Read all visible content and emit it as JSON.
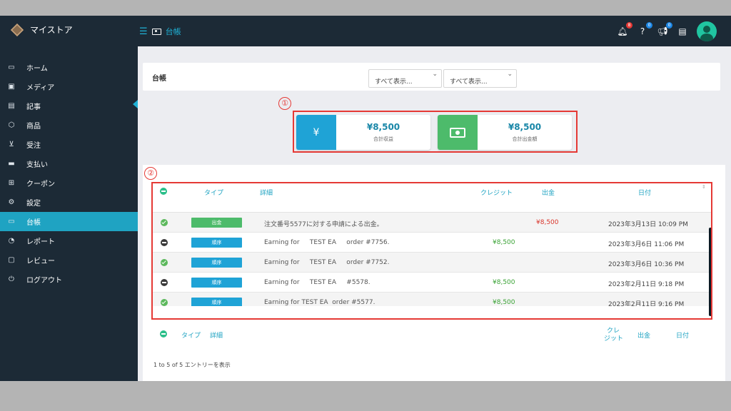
{
  "app": {
    "name": "マイストア"
  },
  "topbar": {
    "breadcrumb": "台帳",
    "notifications_count": "8",
    "help_count": "0",
    "announcements_count": "0",
    "colors": {
      "notif": "#e53935",
      "help": "#1e88e5",
      "announce": "#1e88e5"
    }
  },
  "sidebar": {
    "items": [
      {
        "label": "ホーム",
        "icon": "monitor-icon"
      },
      {
        "label": "メディア",
        "icon": "image-icon"
      },
      {
        "label": "記事",
        "icon": "document-icon"
      },
      {
        "label": "商品",
        "icon": "cube-icon"
      },
      {
        "label": "受注",
        "icon": "cart-icon"
      },
      {
        "label": "支払い",
        "icon": "card-icon"
      },
      {
        "label": "クーポン",
        "icon": "gift-icon"
      },
      {
        "label": "設定",
        "icon": "gears-icon"
      },
      {
        "label": "台帳",
        "icon": "cash-icon",
        "active": true
      },
      {
        "label": "レポート",
        "icon": "chart-icon"
      },
      {
        "label": "レビュー",
        "icon": "comment-icon"
      },
      {
        "label": "ログアウト",
        "icon": "power-icon"
      }
    ]
  },
  "page": {
    "title": "台帳",
    "filter1": "すべて表示...",
    "filter2": "すべて表示...",
    "annotation1": "①",
    "annotation2": "②"
  },
  "stats": [
    {
      "symbol": "¥",
      "amount": "¥8,500",
      "label": "合計収益",
      "color": "#1fa3d6"
    },
    {
      "symbol": "",
      "amount": "¥8,500",
      "label": "合計出金額",
      "color": "#4dbb6b"
    }
  ],
  "table": {
    "headers": {
      "type": "タイプ",
      "detail": "詳細",
      "credit": "クレジット",
      "debit": "出金",
      "date": "日付"
    },
    "footer": {
      "type": "タイプ",
      "detail": "詳細",
      "credit1": "クレ",
      "credit2": "ジット",
      "debit": "出金",
      "date": "日付"
    },
    "rows": [
      {
        "status": "ok",
        "type": "出金",
        "type_color": "#4dbb6b",
        "detail": "注文番号5577に対する申請による出金。",
        "credit": "",
        "debit": "¥8,500",
        "date": "2023年3月13日 10:09 PM"
      },
      {
        "status": "no",
        "type": "順序",
        "type_color": "#1fa3d6",
        "detail": "Earning for     TEST EA     order #7756.",
        "credit": "¥8,500",
        "debit": "",
        "date": "2023年3月6日 11:06 PM"
      },
      {
        "status": "ok",
        "type": "順序",
        "type_color": "#1fa3d6",
        "detail": "Earning for     TEST EA     order #7752.",
        "credit": "",
        "debit": "",
        "date": "2023年3月6日 10:36 PM"
      },
      {
        "status": "no",
        "type": "順序",
        "type_color": "#1fa3d6",
        "detail": "Earning for     TEST EA     #5578.",
        "credit": "¥8,500",
        "debit": "",
        "date": "2023年2月11日 9:18 PM"
      },
      {
        "status": "ok",
        "type": "順序",
        "type_color": "#1fa3d6",
        "detail": "Earning for TEST EA  order #5577.",
        "credit": "¥8,500",
        "debit": "",
        "date": "2023年2月11日 9:16 PM"
      }
    ],
    "entries_info": "1 to 5 of 5 エントリーを表示"
  }
}
